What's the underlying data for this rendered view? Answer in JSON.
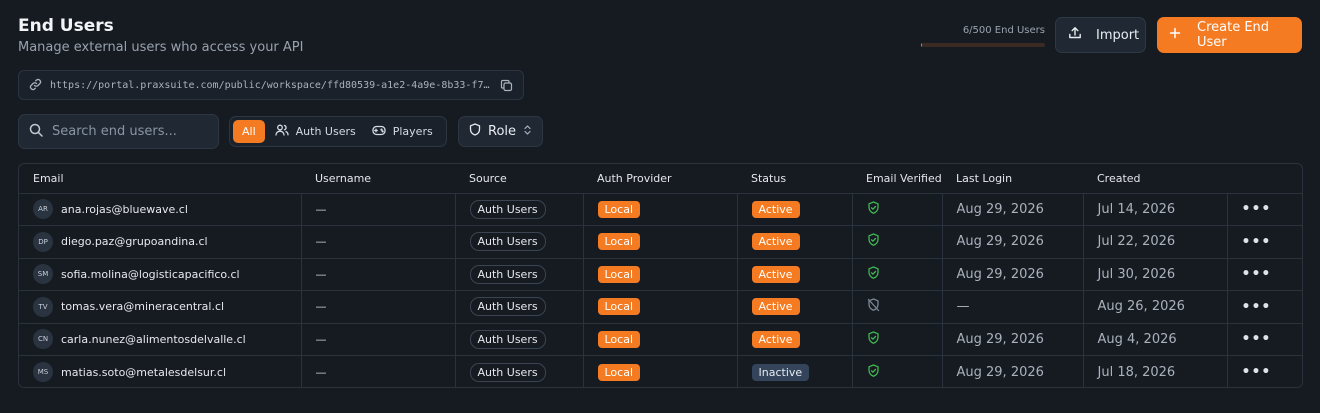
{
  "header": {
    "title": "End Users",
    "subtitle": "Manage external users who access your API",
    "quota_text": "6/500 End Users",
    "quota_fraction": 0.012,
    "import_label": "Import",
    "create_label": "Create End User"
  },
  "portal_url": "https://portal.praxsuite.com/public/workspace/ffd80539-a1e2-4a9e-8b33-f716bf6…",
  "search": {
    "placeholder": "Search end users..."
  },
  "filters": {
    "all": "All",
    "auth_users": "Auth Users",
    "players": "Players"
  },
  "role_label": "Role",
  "colors": {
    "accent": "#f47b22",
    "verified": "#3fb950",
    "inactive_badge": "#34445a"
  },
  "table": {
    "headers": [
      "Email",
      "Username",
      "Source",
      "Auth Provider",
      "Status",
      "Email Verified",
      "Last Login",
      "Created"
    ],
    "rows": [
      {
        "initials": "AR",
        "email": "ana.rojas@bluewave.cl",
        "username": "—",
        "source": "Auth Users",
        "provider": "Local",
        "status": "Active",
        "verified": true,
        "last_login": "Aug 29, 2026",
        "created": "Jul 14, 2026"
      },
      {
        "initials": "DP",
        "email": "diego.paz@grupoandina.cl",
        "username": "—",
        "source": "Auth Users",
        "provider": "Local",
        "status": "Active",
        "verified": true,
        "last_login": "Aug 29, 2026",
        "created": "Jul 22, 2026"
      },
      {
        "initials": "SM",
        "email": "sofia.molina@logisticapacifico.cl",
        "username": "—",
        "source": "Auth Users",
        "provider": "Local",
        "status": "Active",
        "verified": true,
        "last_login": "Aug 29, 2026",
        "created": "Jul 30, 2026"
      },
      {
        "initials": "TV",
        "email": "tomas.vera@mineracentral.cl",
        "username": "—",
        "source": "Auth Users",
        "provider": "Local",
        "status": "Active",
        "verified": false,
        "last_login": "—",
        "created": "Aug 26, 2026"
      },
      {
        "initials": "CN",
        "email": "carla.nunez@alimentosdelvalle.cl",
        "username": "—",
        "source": "Auth Users",
        "provider": "Local",
        "status": "Active",
        "verified": true,
        "last_login": "Aug 29, 2026",
        "created": "Aug 4, 2026"
      },
      {
        "initials": "MS",
        "email": "matias.soto@metalesdelsur.cl",
        "username": "—",
        "source": "Auth Users",
        "provider": "Local",
        "status": "Inactive",
        "verified": true,
        "last_login": "Aug 29, 2026",
        "created": "Jul 18, 2026"
      }
    ]
  }
}
